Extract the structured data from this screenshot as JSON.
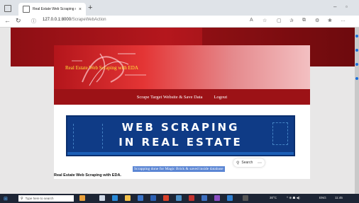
{
  "browser": {
    "tab_title": "Real Estate Web Scraping with E",
    "tab_close": "×",
    "new_tab": "+",
    "url_host": "127.0.0.1:8000",
    "url_path": "/ScrapeWebAction",
    "minimize": "–",
    "maximize": "▫"
  },
  "site": {
    "title": "Real Estate Web Scraping with EDA",
    "menu": [
      {
        "label": "Scrape Target Website & Save Data"
      },
      {
        "label": "Logout"
      }
    ],
    "hero_line1": "WEB SCRAPING",
    "hero_line2": "IN REAL ESTATE",
    "search_label": "Search",
    "status_message": "Scrapping done for Magic Brick & saved inside database",
    "footer_text": "Real Estate Web Scraping with EDA."
  },
  "taskbar": {
    "search_placeholder": "Type here to search",
    "temperature": "30°C",
    "lang": "ENG",
    "time": "11:45"
  },
  "colors": {
    "brand_red": "#9c1216",
    "title_yellow": "#ffe43a",
    "hero_blue": "#0f3b86",
    "selection_blue": "#5b86d4"
  }
}
